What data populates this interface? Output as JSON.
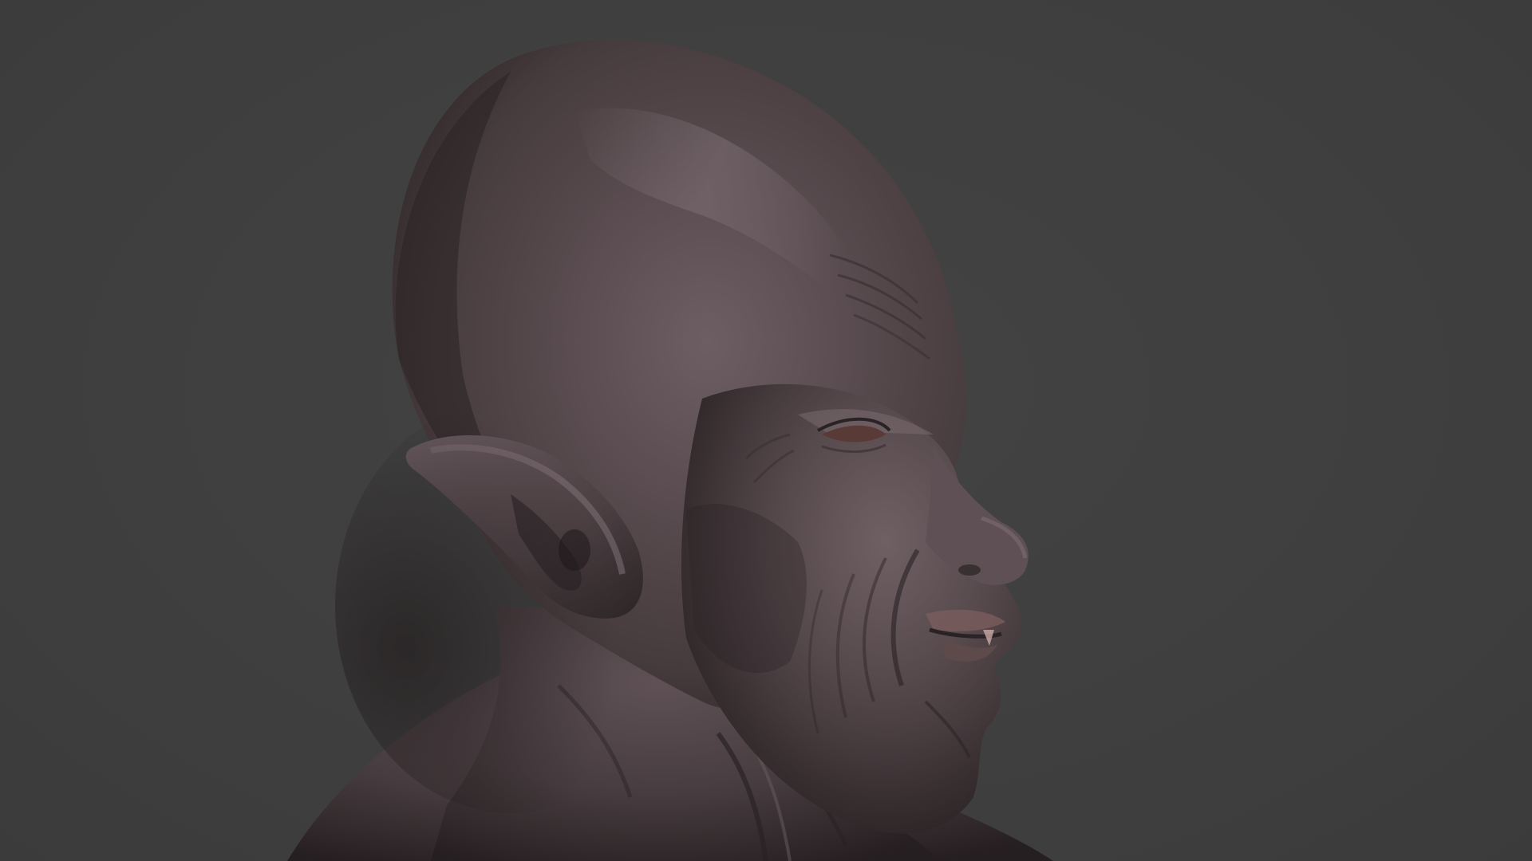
{
  "scene": {
    "subject": "sculpt-bust",
    "colors": {
      "background": "#404040",
      "skin_base": "#4a3e40",
      "skin_light": "#6a5a5e",
      "skin_highlight": "#7b6d72",
      "skin_shadow": "#2a2224",
      "skin_deep_shadow": "#1e1819",
      "eye": "#5a3a36",
      "lip": "#7a5c5c"
    }
  }
}
